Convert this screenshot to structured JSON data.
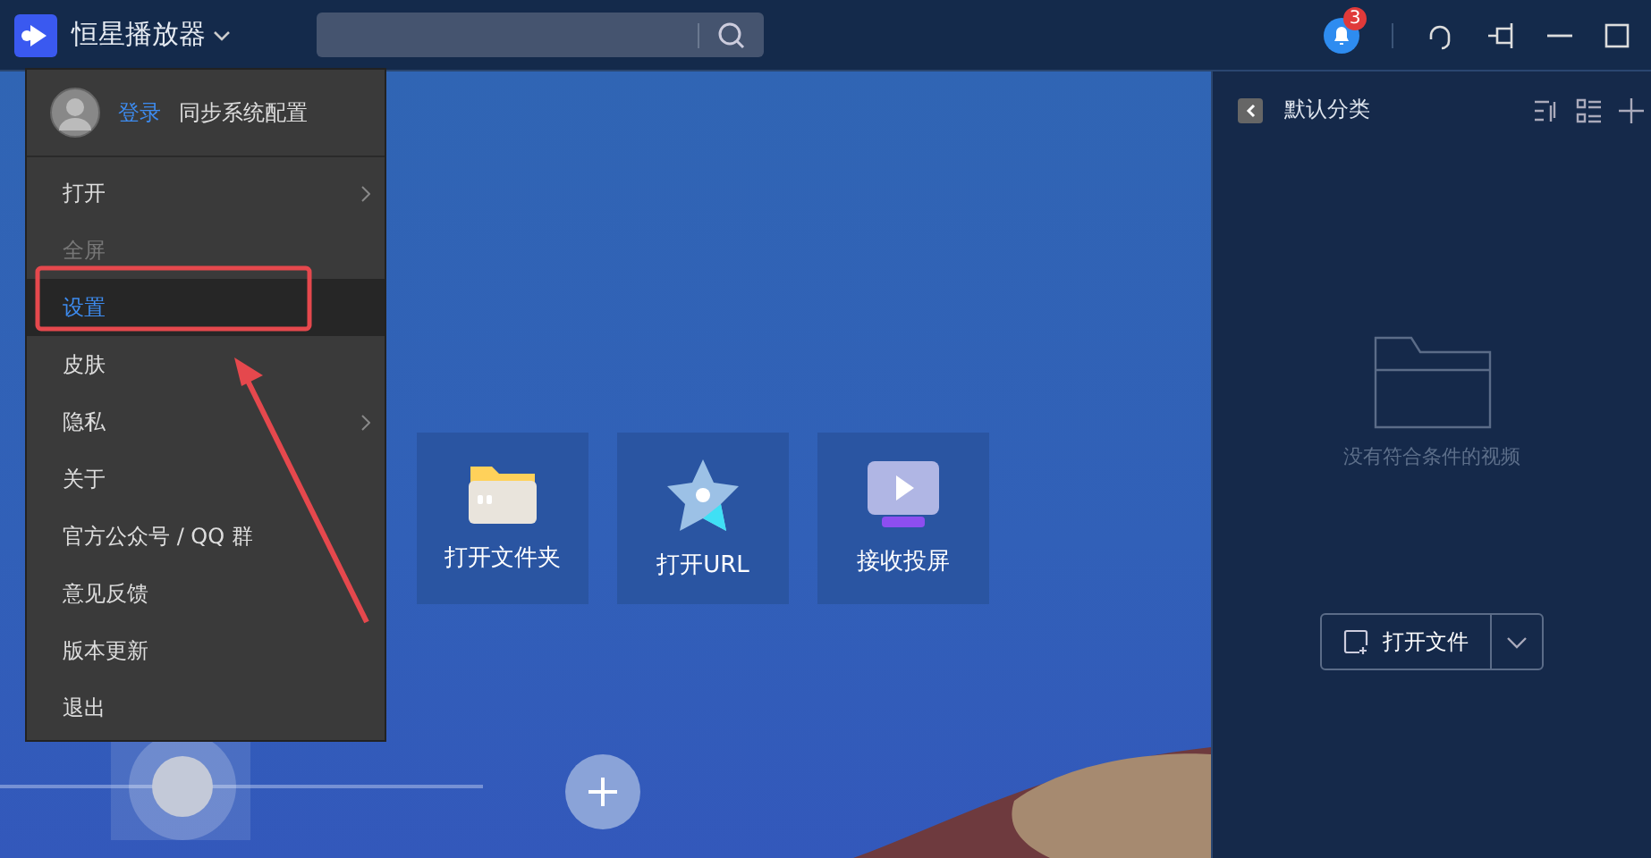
{
  "titlebar": {
    "app_name": "恒星播放器",
    "notification_count": "3"
  },
  "menu": {
    "login": "登录",
    "sync": "同步系统配置",
    "items": [
      {
        "label": "打开",
        "disabled": false,
        "selected": false,
        "has_submenu": true
      },
      {
        "label": "全屏",
        "disabled": true,
        "selected": false,
        "has_submenu": false
      },
      {
        "label": "设置",
        "disabled": false,
        "selected": true,
        "has_submenu": false
      },
      {
        "label": "皮肤",
        "disabled": false,
        "selected": false,
        "has_submenu": false
      },
      {
        "label": "隐私",
        "disabled": false,
        "selected": false,
        "has_submenu": true
      },
      {
        "label": "关于",
        "disabled": false,
        "selected": false,
        "has_submenu": false
      },
      {
        "label": "官方公众号 / QQ 群",
        "disabled": false,
        "selected": false,
        "has_submenu": false
      },
      {
        "label": "意见反馈",
        "disabled": false,
        "selected": false,
        "has_submenu": false
      },
      {
        "label": "版本更新",
        "disabled": false,
        "selected": false,
        "has_submenu": false
      },
      {
        "label": "退出",
        "disabled": false,
        "selected": false,
        "has_submenu": false
      }
    ]
  },
  "tiles": [
    {
      "kind": "folder",
      "label": "打开文件夹"
    },
    {
      "kind": "url",
      "label": "打开URL"
    },
    {
      "kind": "cast",
      "label": "接收投屏"
    }
  ],
  "playlist": {
    "title": "默认分类",
    "empty_text": "没有符合条件的视频",
    "open_button": "打开文件"
  }
}
